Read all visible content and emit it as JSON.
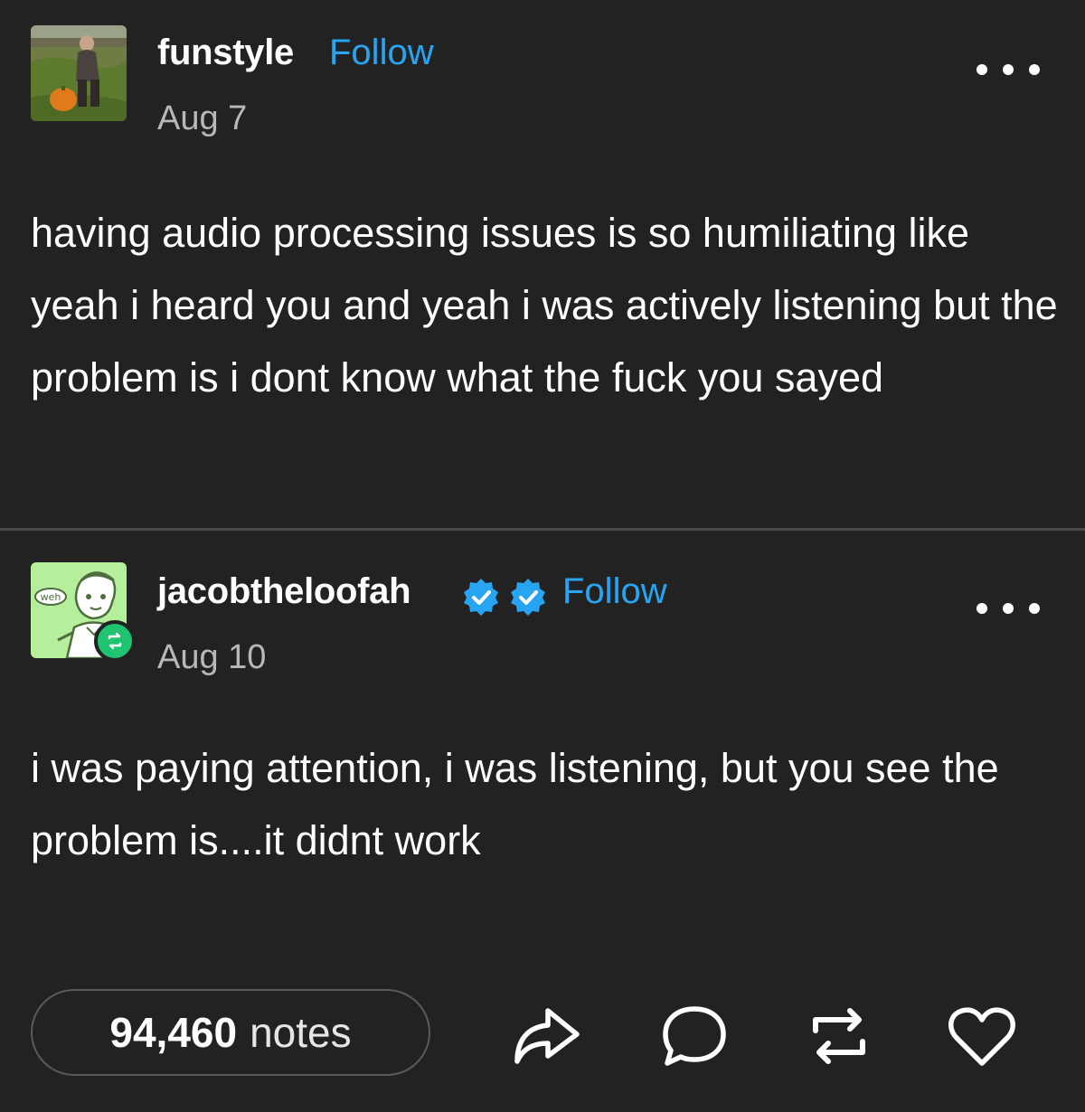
{
  "posts": [
    {
      "username": "funstyle",
      "follow_label": "Follow",
      "date": "Aug 7",
      "avatar": "photo-avatar-person-with-pumpkin",
      "body": "having audio processing issues is so humiliating like yeah i heard you and yeah i was actively listening but the problem is i dont know what the fuck you sayed"
    },
    {
      "username": "jacobtheloofah",
      "follow_label": "Follow",
      "date": "Aug 10",
      "avatar": "drawn-avatar-weh",
      "avatar_text": "weh",
      "badges": [
        "verified-badge-icon",
        "verified-badge-icon"
      ],
      "body": "i was paying attention, i was listening, but you see the problem is....it didnt work"
    }
  ],
  "footer": {
    "notes_count": "94,460",
    "notes_label": "notes",
    "actions": [
      "share-icon",
      "reply-icon",
      "reblog-icon",
      "like-icon"
    ]
  },
  "colors": {
    "background": "#222222",
    "accent": "#27a4f2",
    "reblog_green": "#1fc470",
    "text": "#ffffff",
    "muted": "#b8b8b8"
  }
}
